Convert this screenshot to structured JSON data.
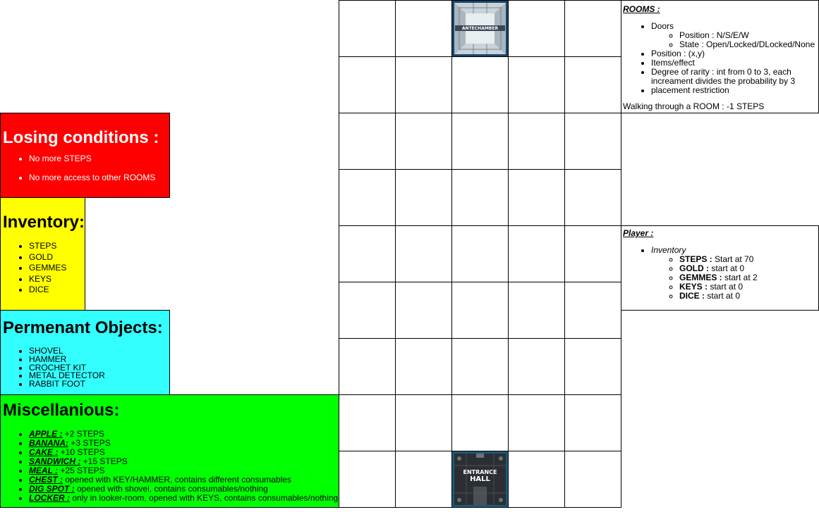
{
  "panels": {
    "losing": {
      "title": "Losing conditions :",
      "items": [
        "No more STEPS",
        "No more access to other ROOMS"
      ]
    },
    "inventory": {
      "title": "Inventory:",
      "items": [
        "STEPS",
        "GOLD",
        "GEMMES",
        "KEYS",
        "DICE"
      ]
    },
    "permanent": {
      "title": "Permenant Objects:",
      "items": [
        "SHOVEL",
        "HAMMER",
        "CROCHET KIT",
        "METAL DETECTOR",
        "RABBIT FOOT"
      ]
    },
    "misc": {
      "title": "Miscellanious:",
      "items": [
        {
          "key": "APPLE :",
          "text": " +2 STEPS"
        },
        {
          "key": "BANANA:",
          "text": " +3 STEPS"
        },
        {
          "key": "CAKE :",
          "text": " +10 STEPS"
        },
        {
          "key": "SANDWICH :",
          "text": " +15 STEPS"
        },
        {
          "key": "MEAL :",
          "text": " +25 STEPS"
        },
        {
          "key": "CHEST :",
          "text": " opened with KEY/HAMMER, contains different consumables"
        },
        {
          "key": "DIG SPOT :",
          "text": " opened with shovel, contains consumables/nothing"
        },
        {
          "key": "LOCKER :",
          "text": " only in looker-room, opened with KEYS, contains consumables/nothing"
        }
      ]
    }
  },
  "rooms_note": {
    "heading": "ROOMS :",
    "doors": "Doors",
    "doors_position": "Position : N/S/E/W",
    "doors_state": "State : Open/Locked/DLocked/None",
    "position": "Position : (x,y)",
    "items_effect": "Items/effect",
    "rarity_1": "Degree of rarity : int from 0 to 3, each",
    "rarity_2": "increament divides the probability by 3",
    "placement": "placement restriction",
    "walking": "Walking through a ROOM : -1 STEPS"
  },
  "player_note": {
    "heading": "Player :",
    "inventory": "Inventory",
    "stats": [
      {
        "key": "STEPS :",
        "text": " Start at 70"
      },
      {
        "key": "GOLD :",
        "text": " start at 0"
      },
      {
        "key": "GEMMES :",
        "text": " start at 2"
      },
      {
        "key": "KEYS :",
        "text": " start at 0"
      },
      {
        "key": "DICE :",
        "text": " start at 0"
      }
    ]
  },
  "tiles": {
    "antechamber": "ANTECHAMBER",
    "entrance_line1": "ENTRANCE",
    "entrance_line2": "HALL"
  },
  "colors": {
    "losing": "#ff0000",
    "inventory": "#ffff00",
    "permanent": "#33ffff",
    "misc": "#00ff00"
  }
}
